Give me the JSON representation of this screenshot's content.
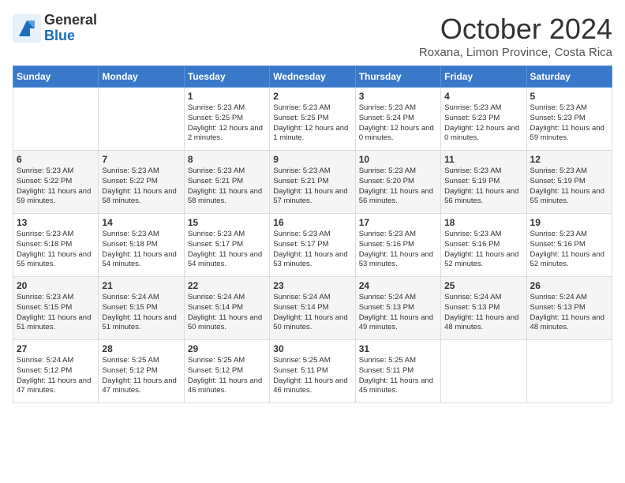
{
  "logo": {
    "general": "General",
    "blue": "Blue"
  },
  "title": "October 2024",
  "subtitle": "Roxana, Limon Province, Costa Rica",
  "days_of_week": [
    "Sunday",
    "Monday",
    "Tuesday",
    "Wednesday",
    "Thursday",
    "Friday",
    "Saturday"
  ],
  "weeks": [
    [
      {
        "day": "",
        "sunrise": "",
        "sunset": "",
        "daylight": ""
      },
      {
        "day": "",
        "sunrise": "",
        "sunset": "",
        "daylight": ""
      },
      {
        "day": "1",
        "sunrise": "Sunrise: 5:23 AM",
        "sunset": "Sunset: 5:25 PM",
        "daylight": "Daylight: 12 hours and 2 minutes."
      },
      {
        "day": "2",
        "sunrise": "Sunrise: 5:23 AM",
        "sunset": "Sunset: 5:25 PM",
        "daylight": "Daylight: 12 hours and 1 minute."
      },
      {
        "day": "3",
        "sunrise": "Sunrise: 5:23 AM",
        "sunset": "Sunset: 5:24 PM",
        "daylight": "Daylight: 12 hours and 0 minutes."
      },
      {
        "day": "4",
        "sunrise": "Sunrise: 5:23 AM",
        "sunset": "Sunset: 5:23 PM",
        "daylight": "Daylight: 12 hours and 0 minutes."
      },
      {
        "day": "5",
        "sunrise": "Sunrise: 5:23 AM",
        "sunset": "Sunset: 5:23 PM",
        "daylight": "Daylight: 11 hours and 59 minutes."
      }
    ],
    [
      {
        "day": "6",
        "sunrise": "Sunrise: 5:23 AM",
        "sunset": "Sunset: 5:22 PM",
        "daylight": "Daylight: 11 hours and 59 minutes."
      },
      {
        "day": "7",
        "sunrise": "Sunrise: 5:23 AM",
        "sunset": "Sunset: 5:22 PM",
        "daylight": "Daylight: 11 hours and 58 minutes."
      },
      {
        "day": "8",
        "sunrise": "Sunrise: 5:23 AM",
        "sunset": "Sunset: 5:21 PM",
        "daylight": "Daylight: 11 hours and 58 minutes."
      },
      {
        "day": "9",
        "sunrise": "Sunrise: 5:23 AM",
        "sunset": "Sunset: 5:21 PM",
        "daylight": "Daylight: 11 hours and 57 minutes."
      },
      {
        "day": "10",
        "sunrise": "Sunrise: 5:23 AM",
        "sunset": "Sunset: 5:20 PM",
        "daylight": "Daylight: 11 hours and 56 minutes."
      },
      {
        "day": "11",
        "sunrise": "Sunrise: 5:23 AM",
        "sunset": "Sunset: 5:19 PM",
        "daylight": "Daylight: 11 hours and 56 minutes."
      },
      {
        "day": "12",
        "sunrise": "Sunrise: 5:23 AM",
        "sunset": "Sunset: 5:19 PM",
        "daylight": "Daylight: 11 hours and 55 minutes."
      }
    ],
    [
      {
        "day": "13",
        "sunrise": "Sunrise: 5:23 AM",
        "sunset": "Sunset: 5:18 PM",
        "daylight": "Daylight: 11 hours and 55 minutes."
      },
      {
        "day": "14",
        "sunrise": "Sunrise: 5:23 AM",
        "sunset": "Sunset: 5:18 PM",
        "daylight": "Daylight: 11 hours and 54 minutes."
      },
      {
        "day": "15",
        "sunrise": "Sunrise: 5:23 AM",
        "sunset": "Sunset: 5:17 PM",
        "daylight": "Daylight: 11 hours and 54 minutes."
      },
      {
        "day": "16",
        "sunrise": "Sunrise: 5:23 AM",
        "sunset": "Sunset: 5:17 PM",
        "daylight": "Daylight: 11 hours and 53 minutes."
      },
      {
        "day": "17",
        "sunrise": "Sunrise: 5:23 AM",
        "sunset": "Sunset: 5:16 PM",
        "daylight": "Daylight: 11 hours and 53 minutes."
      },
      {
        "day": "18",
        "sunrise": "Sunrise: 5:23 AM",
        "sunset": "Sunset: 5:16 PM",
        "daylight": "Daylight: 11 hours and 52 minutes."
      },
      {
        "day": "19",
        "sunrise": "Sunrise: 5:23 AM",
        "sunset": "Sunset: 5:16 PM",
        "daylight": "Daylight: 11 hours and 52 minutes."
      }
    ],
    [
      {
        "day": "20",
        "sunrise": "Sunrise: 5:23 AM",
        "sunset": "Sunset: 5:15 PM",
        "daylight": "Daylight: 11 hours and 51 minutes."
      },
      {
        "day": "21",
        "sunrise": "Sunrise: 5:24 AM",
        "sunset": "Sunset: 5:15 PM",
        "daylight": "Daylight: 11 hours and 51 minutes."
      },
      {
        "day": "22",
        "sunrise": "Sunrise: 5:24 AM",
        "sunset": "Sunset: 5:14 PM",
        "daylight": "Daylight: 11 hours and 50 minutes."
      },
      {
        "day": "23",
        "sunrise": "Sunrise: 5:24 AM",
        "sunset": "Sunset: 5:14 PM",
        "daylight": "Daylight: 11 hours and 50 minutes."
      },
      {
        "day": "24",
        "sunrise": "Sunrise: 5:24 AM",
        "sunset": "Sunset: 5:13 PM",
        "daylight": "Daylight: 11 hours and 49 minutes."
      },
      {
        "day": "25",
        "sunrise": "Sunrise: 5:24 AM",
        "sunset": "Sunset: 5:13 PM",
        "daylight": "Daylight: 11 hours and 48 minutes."
      },
      {
        "day": "26",
        "sunrise": "Sunrise: 5:24 AM",
        "sunset": "Sunset: 5:13 PM",
        "daylight": "Daylight: 11 hours and 48 minutes."
      }
    ],
    [
      {
        "day": "27",
        "sunrise": "Sunrise: 5:24 AM",
        "sunset": "Sunset: 5:12 PM",
        "daylight": "Daylight: 11 hours and 47 minutes."
      },
      {
        "day": "28",
        "sunrise": "Sunrise: 5:25 AM",
        "sunset": "Sunset: 5:12 PM",
        "daylight": "Daylight: 11 hours and 47 minutes."
      },
      {
        "day": "29",
        "sunrise": "Sunrise: 5:25 AM",
        "sunset": "Sunset: 5:12 PM",
        "daylight": "Daylight: 11 hours and 46 minutes."
      },
      {
        "day": "30",
        "sunrise": "Sunrise: 5:25 AM",
        "sunset": "Sunset: 5:11 PM",
        "daylight": "Daylight: 11 hours and 46 minutes."
      },
      {
        "day": "31",
        "sunrise": "Sunrise: 5:25 AM",
        "sunset": "Sunset: 5:11 PM",
        "daylight": "Daylight: 11 hours and 45 minutes."
      },
      {
        "day": "",
        "sunrise": "",
        "sunset": "",
        "daylight": ""
      },
      {
        "day": "",
        "sunrise": "",
        "sunset": "",
        "daylight": ""
      }
    ]
  ]
}
